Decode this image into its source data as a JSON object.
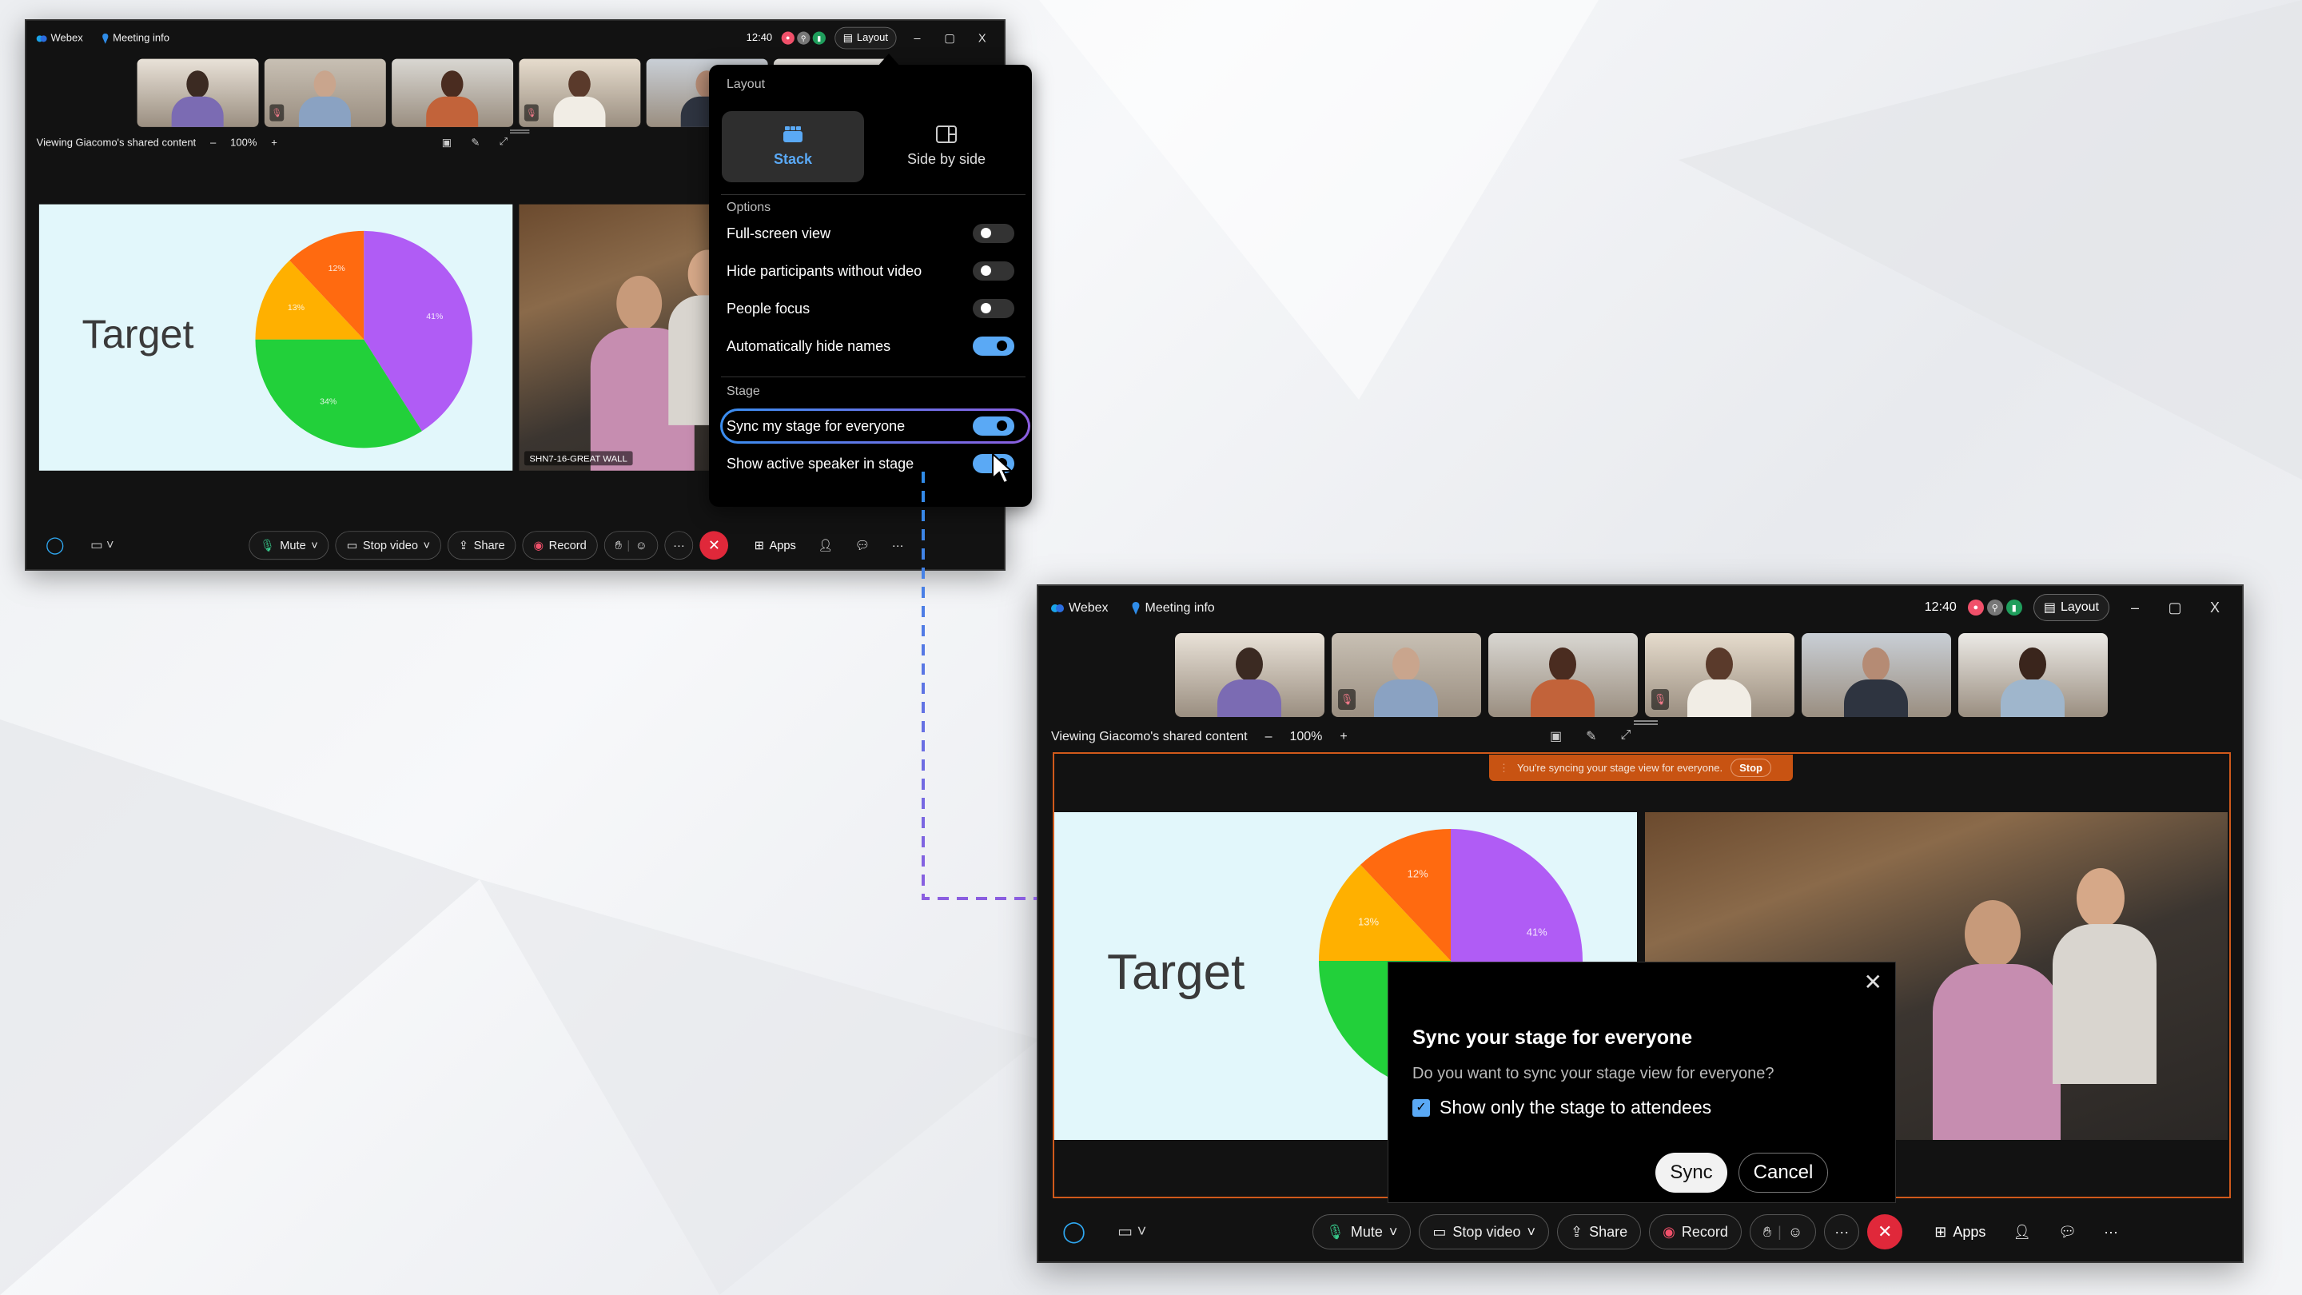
{
  "colors": {
    "accent": "#5aa9f5",
    "sync_banner": "#c85312",
    "end_call": "#e0283a",
    "stage_frame": "#d0591b"
  },
  "titlebar": {
    "app": "Webex",
    "meeting_info": "Meeting info",
    "time": "12:40",
    "layout": "Layout",
    "minimize": "–",
    "maximize": "▢",
    "close": "X"
  },
  "viewing": {
    "text": "Viewing Giacomo's shared content",
    "zoom_out": "–",
    "zoom": "100%",
    "zoom_in": "+"
  },
  "shared_content": {
    "title": "Target",
    "chart_data": {
      "type": "pie",
      "categories": [
        "41%",
        "34%",
        "13%",
        "12%"
      ],
      "values": [
        41,
        34,
        13,
        12
      ],
      "colors": [
        "#b05cf5",
        "#22d03a",
        "#ffb000",
        "#ff6a10"
      ]
    }
  },
  "video_label": "SHN7-16-GREAT WALL",
  "sync_banner": {
    "text": "You're syncing your stage view for everyone.",
    "stop": "Stop"
  },
  "toolbar": {
    "mute": "Mute",
    "stop_video": "Stop video",
    "share": "Share",
    "record": "Record",
    "more": "···",
    "apps": "Apps",
    "more_right": "···"
  },
  "layout_popup": {
    "layout_heading": "Layout",
    "stack": "Stack",
    "side_by_side": "Side by side",
    "options_heading": "Options",
    "options": [
      {
        "label": "Full-screen view",
        "on": false
      },
      {
        "label": "Hide participants without video",
        "on": false
      },
      {
        "label": "People focus",
        "on": false
      },
      {
        "label": "Automatically hide names",
        "on": true
      }
    ],
    "stage_heading": "Stage",
    "stage": [
      {
        "label": "Sync my stage for everyone",
        "on": true
      },
      {
        "label": "Show active speaker in stage",
        "on": true
      }
    ]
  },
  "dialog": {
    "title": "Sync your stage for everyone",
    "question": "Do you want to sync your stage view for everyone?",
    "checkbox": "Show only the stage to attendees",
    "checked": true,
    "sync": "Sync",
    "cancel": "Cancel",
    "close": "✕"
  }
}
